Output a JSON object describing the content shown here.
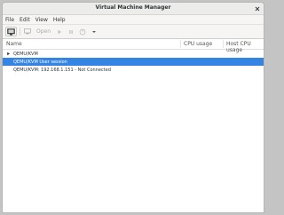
{
  "window": {
    "title": "Virtual Machine Manager"
  },
  "menu": [
    "File",
    "Edit",
    "View",
    "Help"
  ],
  "toolbar": {
    "open_label": "Open"
  },
  "columns": {
    "name": "Name",
    "cpu": "CPU usage",
    "host_cpu": "Host CPU usage"
  },
  "connections": [
    {
      "label": "QEMU/KVM",
      "expanded": true
    },
    {
      "label": "QEMU/KVM User session",
      "selected": true
    },
    {
      "label": "QEMU/KVM: 192.168.1.151 - Not Connected"
    }
  ],
  "colors": {
    "selection": "#3584e4",
    "window_bg": "#ffffff",
    "chrome_bg": "#f6f5f4"
  },
  "icons": [
    "close-icon",
    "new-vm-icon",
    "run-icon",
    "pause-icon",
    "power-icon",
    "chevron-down-icon",
    "expander-icon"
  ]
}
